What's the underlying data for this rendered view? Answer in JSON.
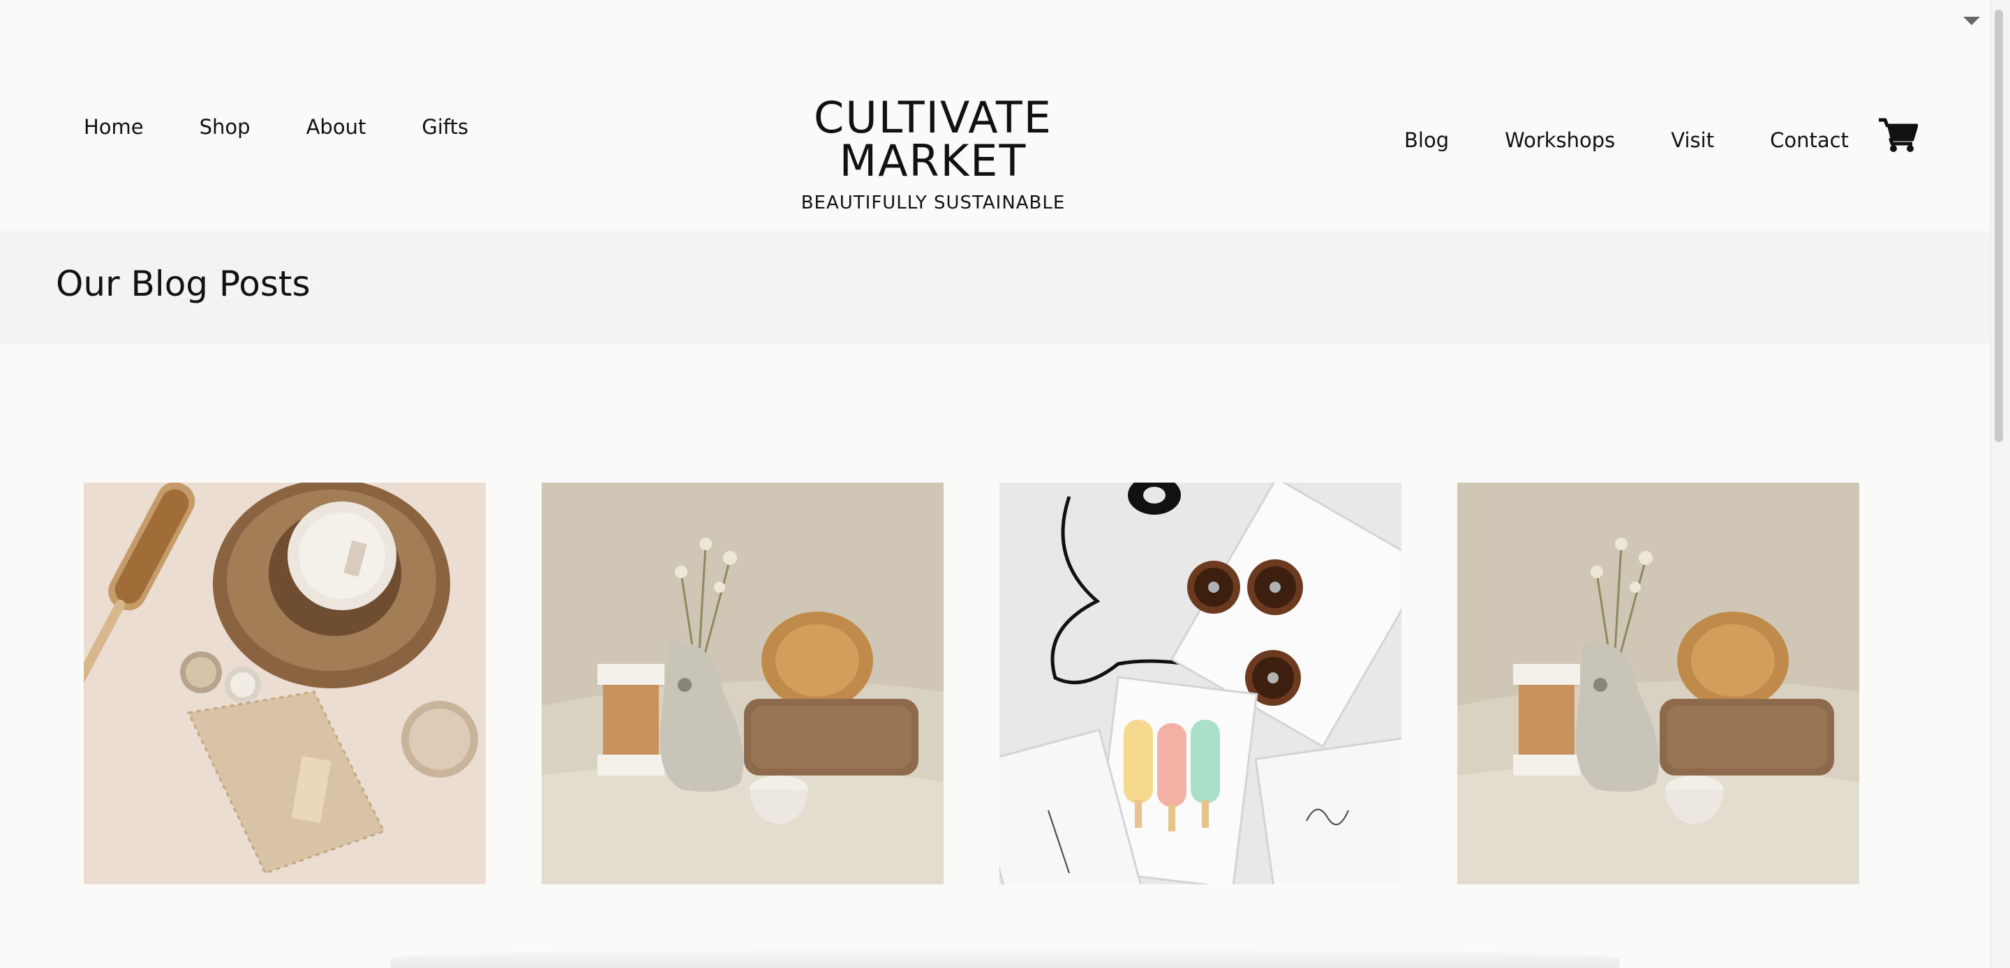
{
  "header": {
    "nav_left": [
      "Home",
      "Shop",
      "About",
      "Gifts"
    ],
    "nav_right": [
      "Blog",
      "Workshops",
      "Visit",
      "Contact"
    ],
    "brand_title": "CULTIVATE MARKET",
    "brand_subtitle": "BEAUTIFULLY SUSTAINABLE",
    "cart_icon": "shopping-cart-icon"
  },
  "page": {
    "heading": "Our Blog Posts"
  },
  "posts": [
    {
      "image": "bath-accessories-flatlay"
    },
    {
      "image": "pumice-stone-still-life"
    },
    {
      "image": "donuts-and-popsicles-boxes"
    },
    {
      "image": "pumice-stone-still-life"
    }
  ],
  "colors": {
    "background": "#fafaf8",
    "band": "#f3f3f1",
    "text": "#111111"
  }
}
